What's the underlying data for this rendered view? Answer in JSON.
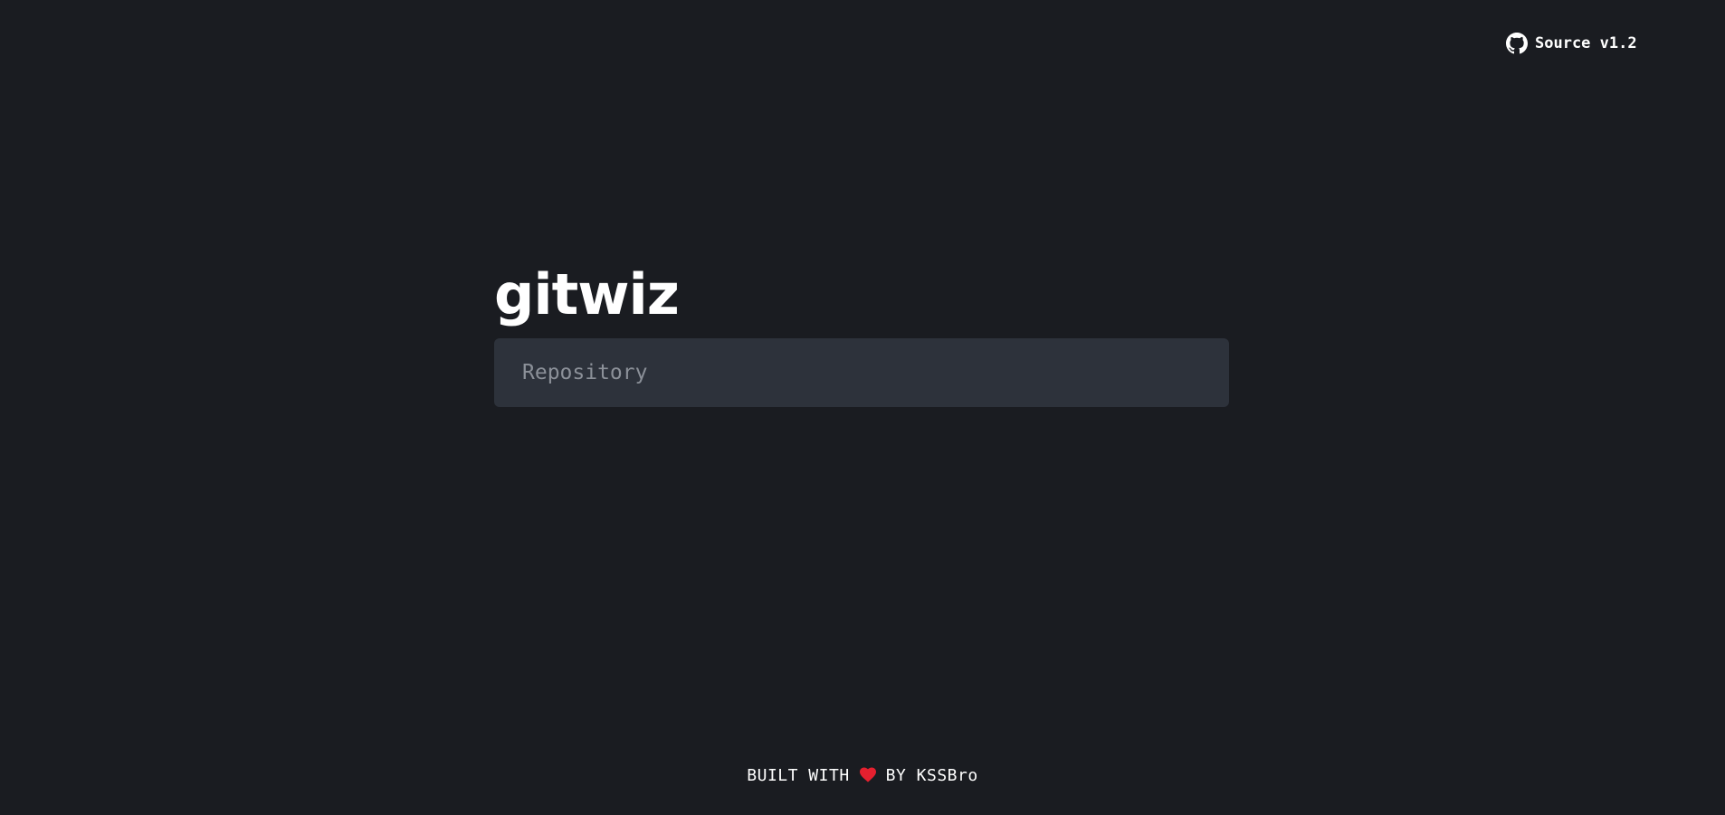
{
  "header": {
    "source_label": "Source v1.2",
    "source_icon": "github-icon"
  },
  "main": {
    "title": "gitwiz",
    "repo_input": {
      "value": "",
      "placeholder": "Repository"
    }
  },
  "footer": {
    "built_with": "BUILT WITH",
    "heart_icon": "heart-icon",
    "by": "BY KSSBro"
  },
  "colors": {
    "background": "#1a1c21",
    "input_background": "#2d323b",
    "placeholder": "#8b9098",
    "heart": "#e5202f",
    "text": "#ffffff"
  }
}
